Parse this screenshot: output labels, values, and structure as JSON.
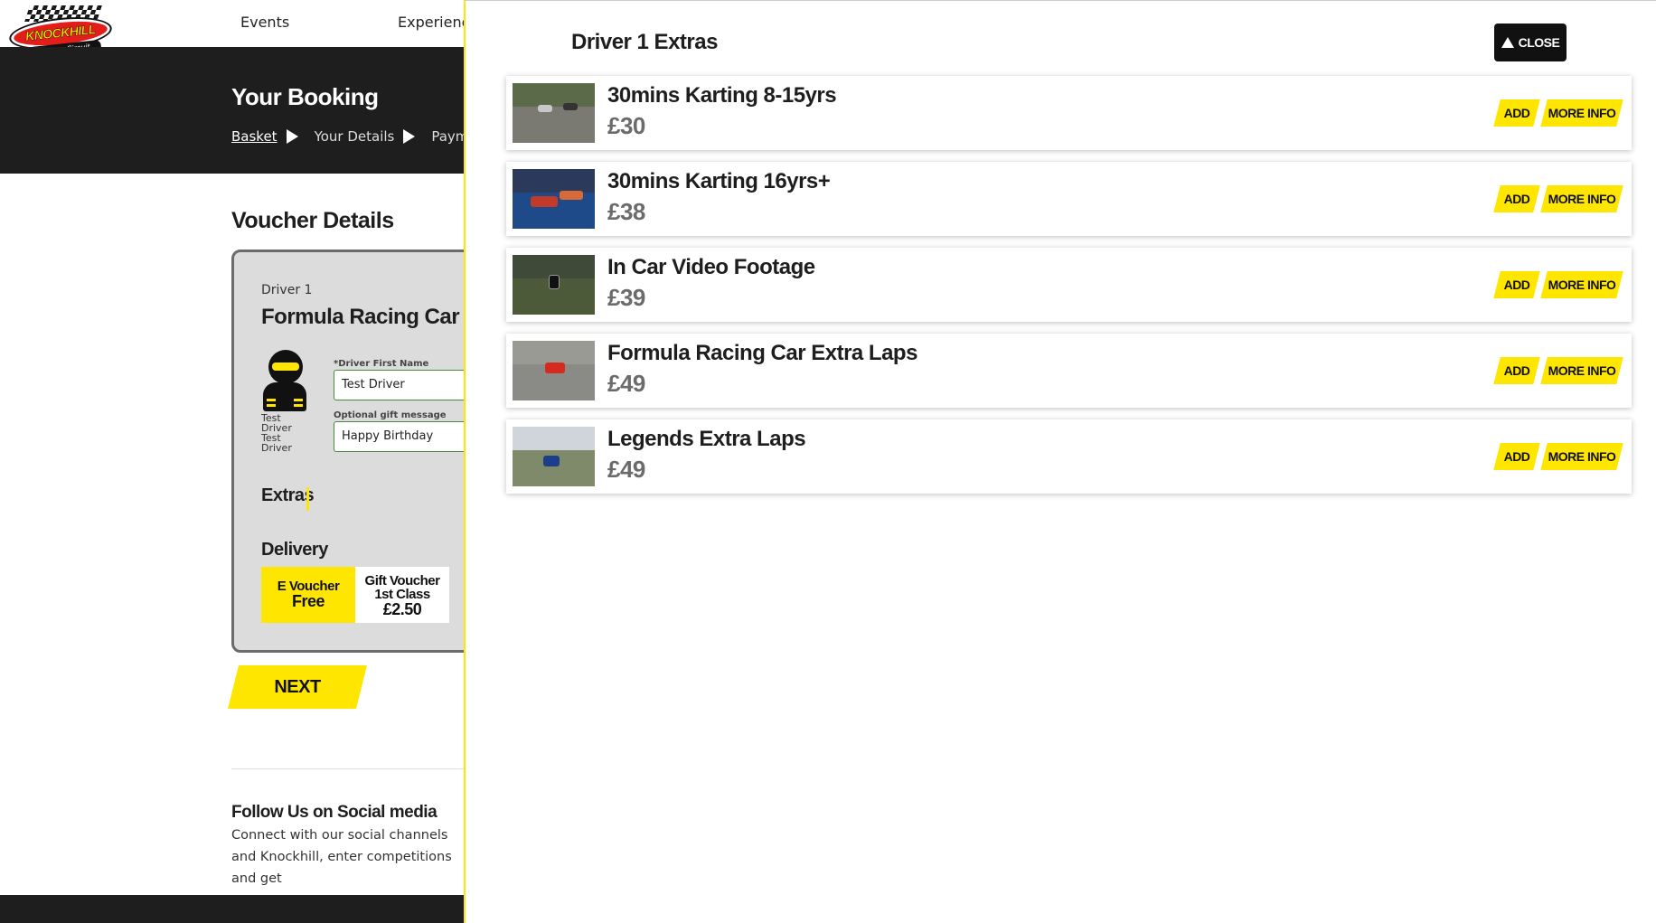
{
  "nav": {
    "items": [
      "Events",
      "Experienc"
    ]
  },
  "logo": {
    "text": "KNOCKHILL",
    "subtext": "Racing Circuit"
  },
  "booking": {
    "title": "Your Booking",
    "breadcrumbs": [
      "Basket",
      "Your Details",
      "Payme"
    ]
  },
  "voucher": {
    "section_title": "Voucher Details",
    "driver_label": "Driver 1",
    "experience_title": "Formula Racing Car Experi",
    "driver_names": "Test Driver Test Driver",
    "first_name_label": "*Driver First Name",
    "first_name_value": "Test Driver",
    "gift_label": "Optional gift message",
    "gift_value": "Happy Birthday",
    "extras_label": "Extras",
    "delivery_label": "Delivery",
    "delivery_options": [
      {
        "line1": "E Voucher",
        "price": "Free"
      },
      {
        "line1": "Gift Voucher",
        "line2": "1st Class",
        "price": "£2.50"
      }
    ],
    "next_label": "NEXT"
  },
  "footer": {
    "follow_title": "Follow Us on Social media",
    "follow_text": "Connect with our social channels and Knockhill, enter competitions and get"
  },
  "panel": {
    "title": "Driver 1 Extras",
    "close_label": "CLOSE",
    "add_label": "ADD",
    "more_info_label": "MORE INFO",
    "extras": [
      {
        "name": "30mins Karting 8-15yrs",
        "price": "£30"
      },
      {
        "name": "30mins Karting 16yrs+",
        "price": "£38"
      },
      {
        "name": "In Car Video Footage",
        "price": "£39"
      },
      {
        "name": "Formula Racing Car Extra Laps",
        "price": "£49"
      },
      {
        "name": "Legends Extra Laps",
        "price": "£49"
      }
    ]
  },
  "colors": {
    "accent": "#ffe600",
    "dark": "#1e1e1e",
    "card_bg": "#dcdcdc",
    "price_grey": "#6b6b6b"
  }
}
